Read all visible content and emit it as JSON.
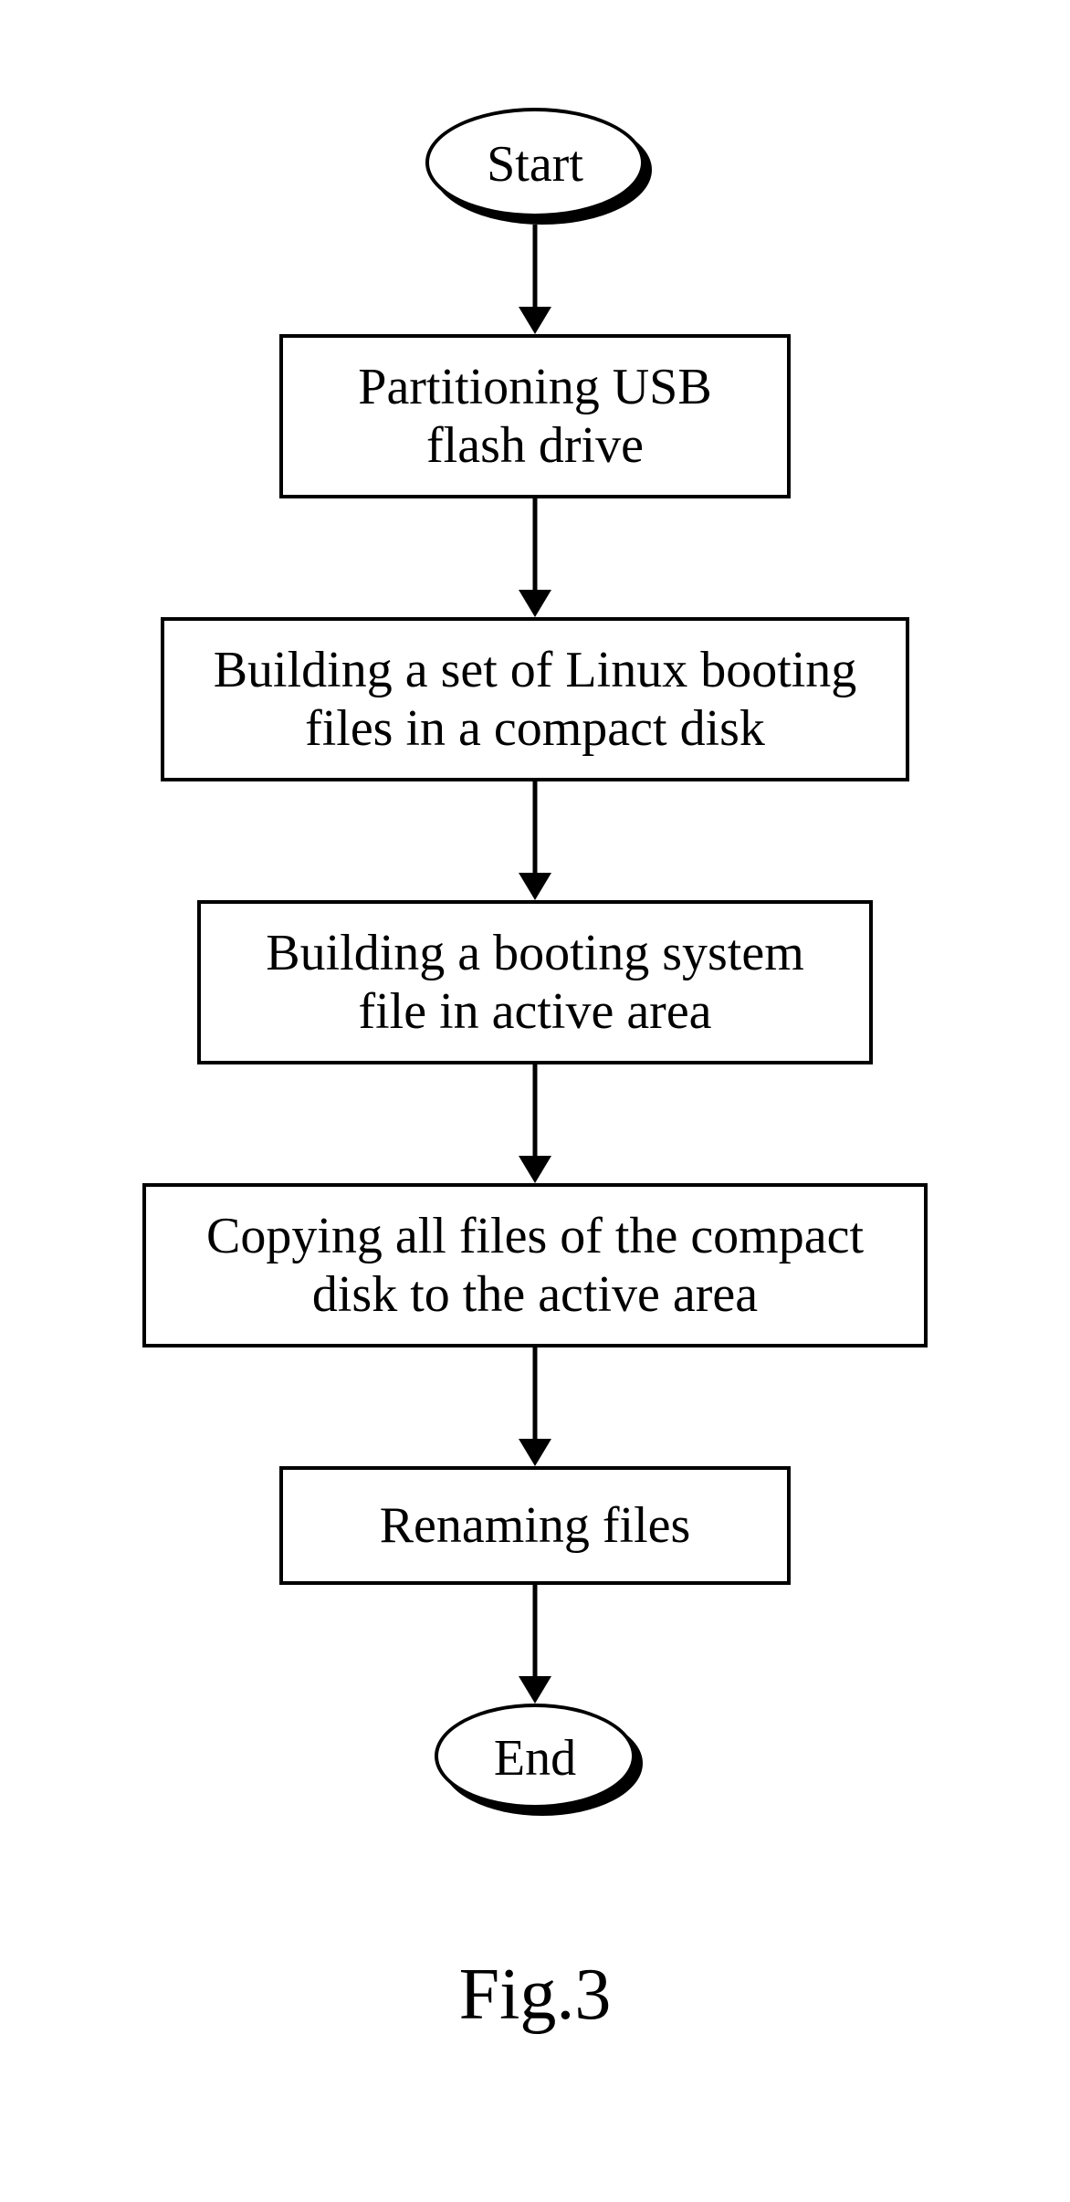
{
  "figure_label": "Fig.3",
  "flow": {
    "start": "Start",
    "end": "End",
    "steps": [
      "Partitioning USB\nflash drive",
      "Building a set of Linux booting\nfiles in a compact disk",
      "Building a booting system\nfile in active area",
      "Copying all files of the compact\ndisk to the active area",
      "Renaming files"
    ]
  }
}
